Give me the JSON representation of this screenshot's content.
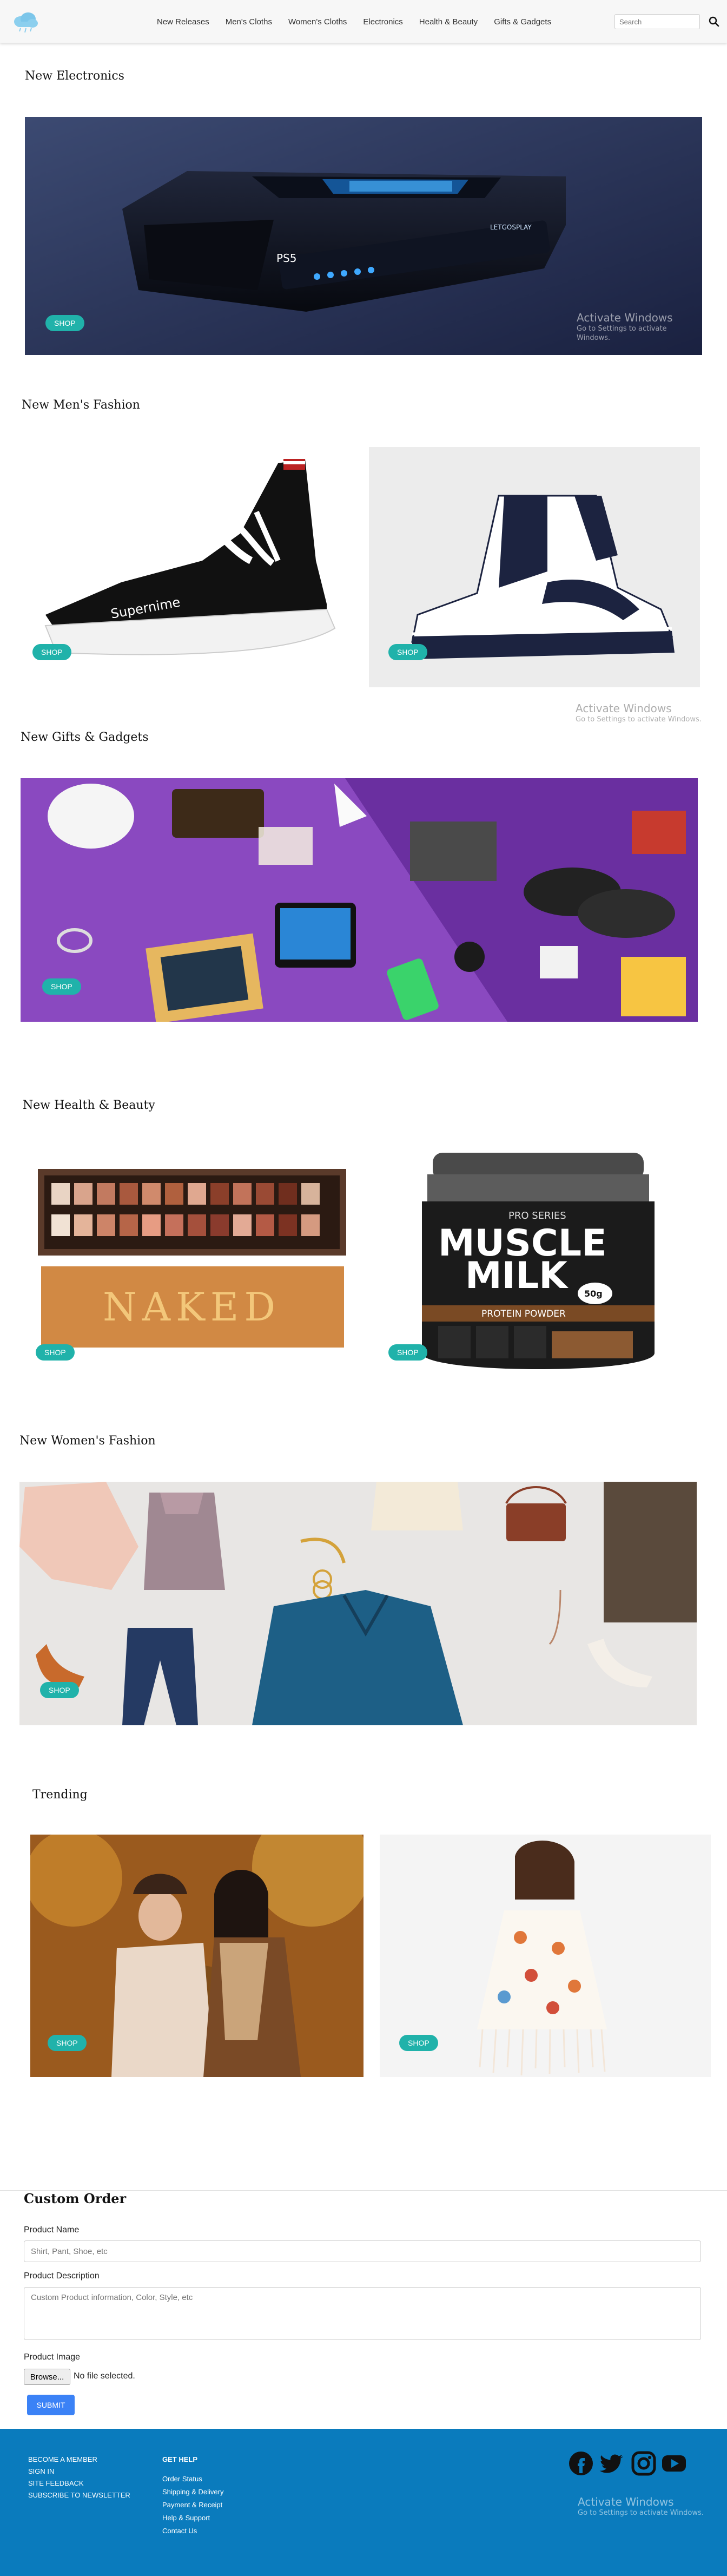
{
  "nav": {
    "links": [
      "New Releases",
      "Men's Cloths",
      "Women's Cloths",
      "Electronics",
      "Health & Beauty",
      "Gifts & Gadgets"
    ],
    "search_placeholder": "Search"
  },
  "sections": {
    "electronics": "New Electronics",
    "mens": "New Men's Fashion",
    "gifts": "New Gifts & Gadgets",
    "health": "New Health & Beauty",
    "womens": "New Women's Fashion",
    "trending": "Trending"
  },
  "shop_label": "SHOP",
  "image_text": {
    "sneaker_brand": "Supernime",
    "console_logo": "PS5",
    "console_badge": "LETGOSPLAY",
    "palette_label": "NAKED",
    "muscle_milk": {
      "series": "PRO SERIES",
      "line1": "MUSCLE",
      "line2": "MILK",
      "protein_badge": "50g",
      "subtitle": "PROTEIN POWDER"
    }
  },
  "watermark": {
    "title": "Activate Windows",
    "subtitle": "Go to Settings to activate Windows."
  },
  "custom_order": {
    "title": "Custom Order",
    "product_name_label": "Product Name",
    "product_name_placeholder": "Shirt, Pant, Shoe, etc",
    "product_description_label": "Product Description",
    "product_description_placeholder": "Custom Product information, Color, Style, etc",
    "product_image_label": "Product Image",
    "browse_label": "Browse...",
    "file_status": "No file selected.",
    "submit_label": "SUBMIT"
  },
  "footer": {
    "left_links": [
      "BECOME A MEMBER",
      "SIGN IN",
      "SITE FEEDBACK",
      "SUBSCRIBE TO NEWSLETTER"
    ],
    "help_heading": "GET HELP",
    "help_links": [
      "Order Status",
      "Shipping & Delivery",
      "Payment & Receipt",
      "Help & Support",
      "Contact Us"
    ],
    "social_icons": [
      "facebook-icon",
      "twitter-icon",
      "instagram-icon",
      "youtube-icon"
    ]
  },
  "colors": {
    "accent_teal": "#20b2aa",
    "footer_blue": "#0a7bbd",
    "submit_blue": "#3b82f6"
  }
}
